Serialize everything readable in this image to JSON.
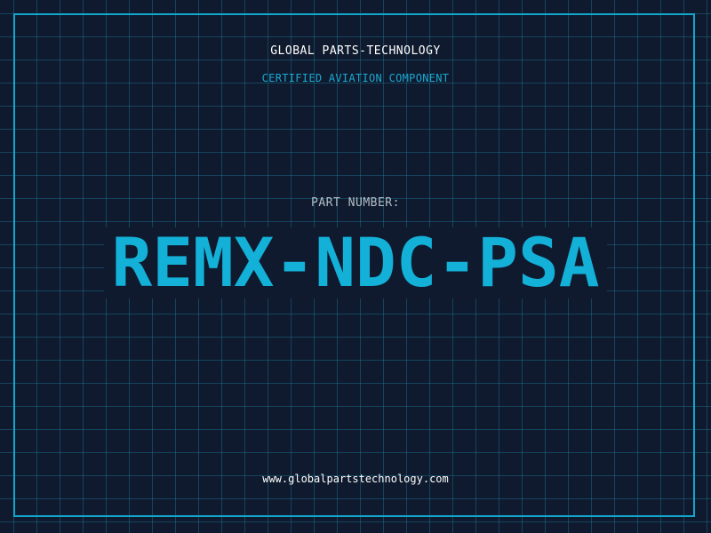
{
  "header": {
    "company": "GLOBAL PARTS-TECHNOLOGY",
    "subtitle": "CERTIFIED AVIATION COMPONENT"
  },
  "part": {
    "label": "PART NUMBER:",
    "number": "REMX-NDC-PSA"
  },
  "footer": {
    "url": "www.globalpartstechnology.com"
  },
  "colors": {
    "background": "#0f1a2e",
    "grid": "#1c7896",
    "accent": "#13b0d8",
    "text": "#ffffff",
    "label": "#b4bdc7"
  }
}
